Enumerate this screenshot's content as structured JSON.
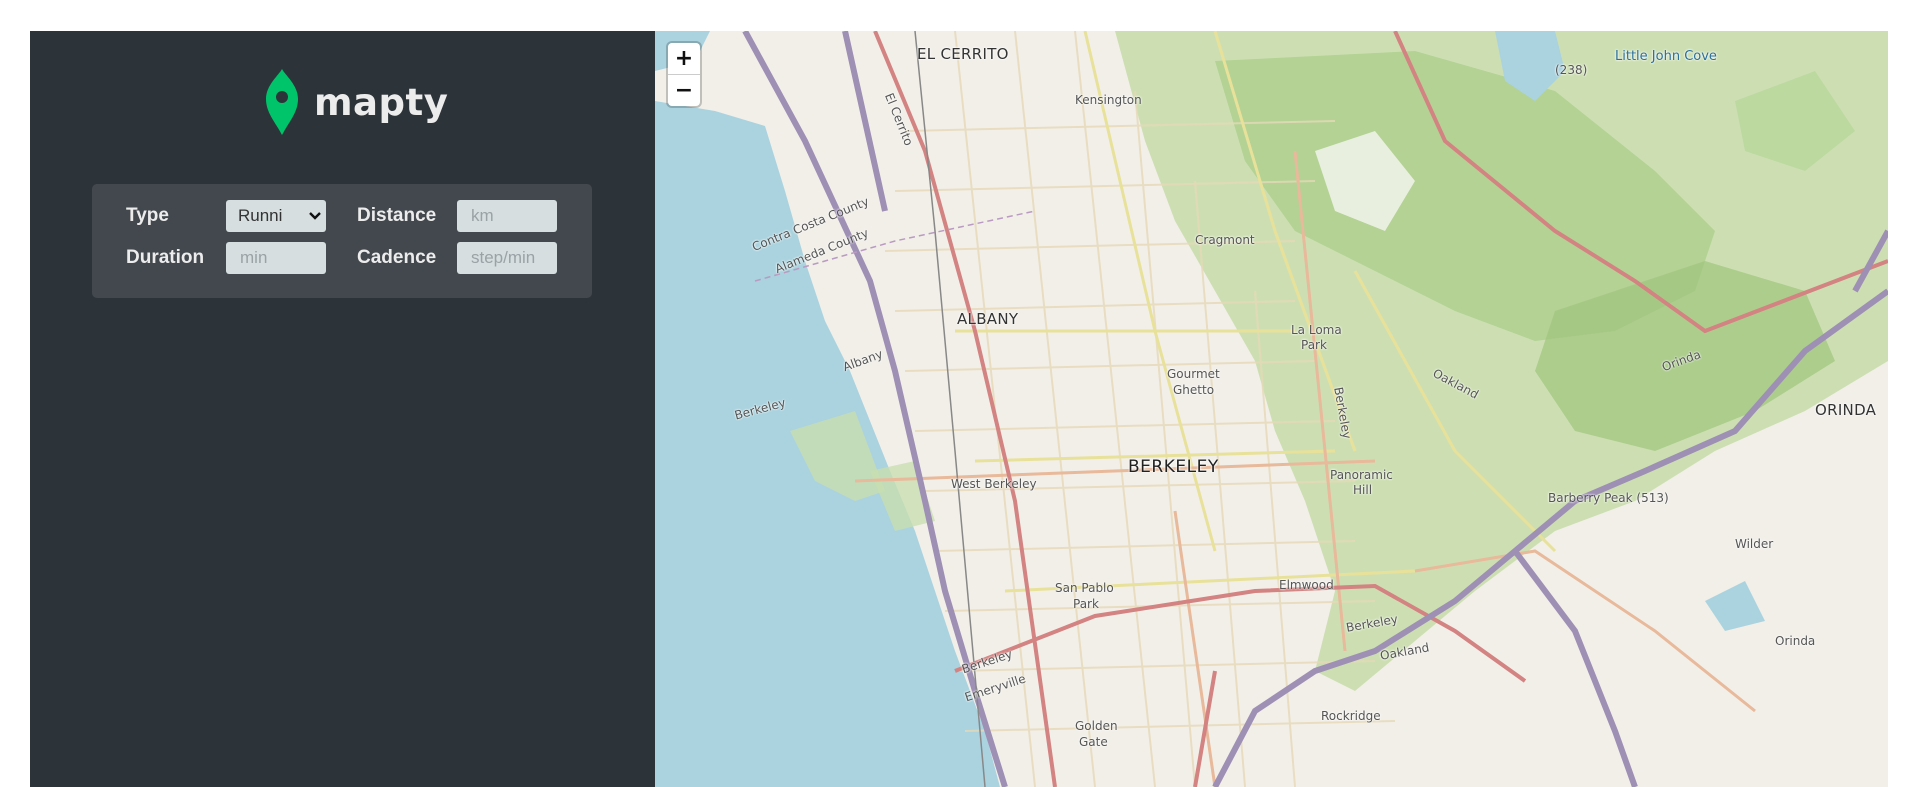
{
  "app": {
    "name": "mapty",
    "accent": "#00c46a",
    "sidebar_bg": "#2d3439",
    "form_bg": "#42484d"
  },
  "form": {
    "type_label": "Type",
    "type_value": "Runni",
    "type_options": [
      "Running"
    ],
    "distance_label": "Distance",
    "distance_placeholder": "km",
    "duration_label": "Duration",
    "duration_placeholder": "min",
    "cadence_label": "Cadence",
    "cadence_placeholder": "step/min"
  },
  "map": {
    "zoom_in": "+",
    "zoom_out": "−",
    "labels": {
      "el_cerrito": "EL CERRITO",
      "el_cerrito_road": "El Cerrito",
      "kensington": "Kensington",
      "little_john_cove": "Little John Cove",
      "route_238": "(238)",
      "contra_costa": "Contra Costa County",
      "alameda_county": "Alameda County",
      "cragmont": "Cragmont",
      "albany_city": "ALBANY",
      "albany": "Albany",
      "la_loma": "La Loma",
      "park": "Park",
      "berkeley_water": "Berkeley",
      "gourmet": "Gourmet",
      "ghetto": "Ghetto",
      "berkeley_vertical": "Berkeley",
      "oakland_hills": "Oakland",
      "orinda_road": "Orinda",
      "orinda_city": "ORINDA",
      "berkeley_city": "BERKELEY",
      "west_berkeley": "West Berkeley",
      "panoramic": "Panoramic",
      "hill": "Hill",
      "barberry_peak": "Barberry Peak (513)",
      "wilder": "Wilder",
      "san_pablo": "San Pablo",
      "park2": "Park",
      "elmwood": "Elmwood",
      "berkeley_south": "Berkeley",
      "oakland": "Oakland",
      "berkeley_shore": "Berkeley",
      "emeryville": "Emeryville",
      "orinda_small": "Orinda",
      "rockridge": "Rockridge",
      "golden": "Golden",
      "gate": "Gate"
    }
  }
}
